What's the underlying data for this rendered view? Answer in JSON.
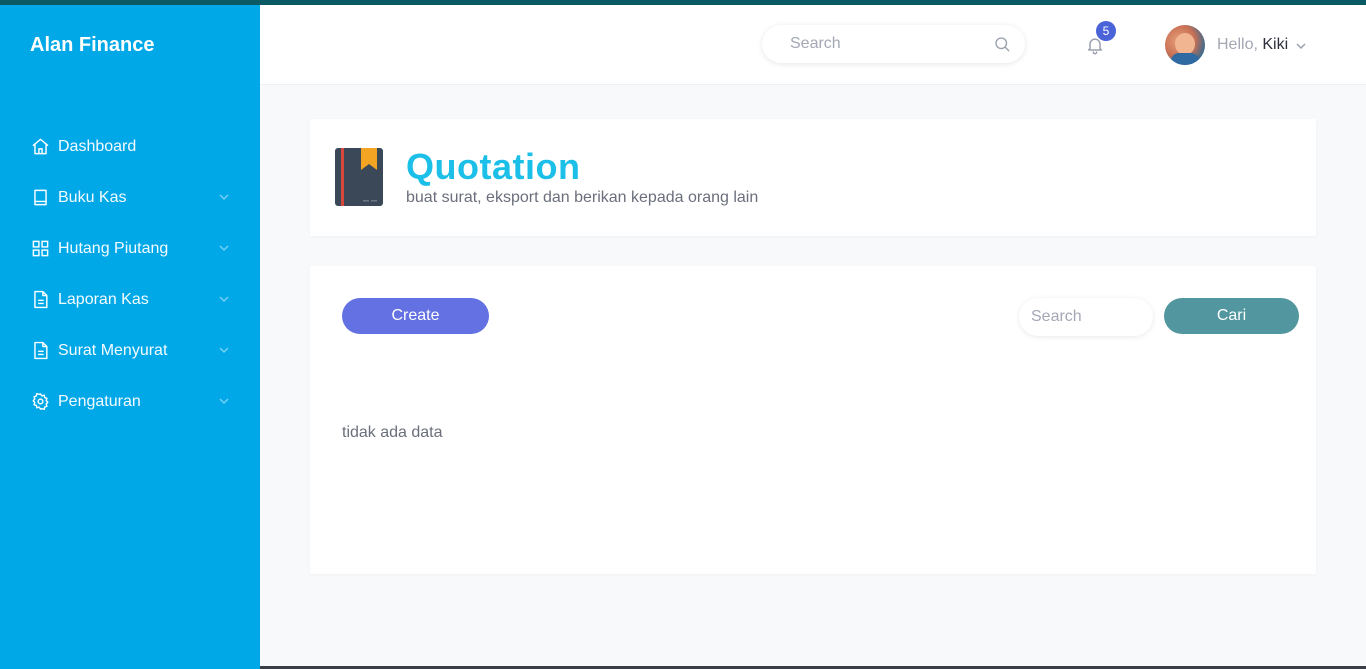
{
  "app": {
    "brand": "Alan Finance"
  },
  "sidebar": {
    "items": [
      {
        "label": "Dashboard",
        "icon": "home-icon",
        "has_submenu": false
      },
      {
        "label": "Buku Kas",
        "icon": "book-icon",
        "has_submenu": true
      },
      {
        "label": "Hutang Piutang",
        "icon": "grid-icon",
        "has_submenu": true
      },
      {
        "label": "Laporan Kas",
        "icon": "file-icon",
        "has_submenu": true
      },
      {
        "label": "Surat Menyurat",
        "icon": "file-icon",
        "has_submenu": true
      },
      {
        "label": "Pengaturan",
        "icon": "gear-icon",
        "has_submenu": true
      }
    ]
  },
  "topbar": {
    "search_placeholder": "Search",
    "notification_count": "5",
    "greeting": "Hello,",
    "user_name": "Kiki"
  },
  "page": {
    "title": "Quotation",
    "subtitle": "buat surat, eksport dan berikan kepada orang lain"
  },
  "content": {
    "create_label": "Create",
    "search_placeholder": "Search",
    "search_button_label": "Cari",
    "empty_message": "tidak ada data"
  },
  "colors": {
    "sidebar_bg": "#00a8e8",
    "title": "#1bbfe8",
    "create_button": "#6371e3",
    "search_button": "#5297a0",
    "badge": "#4b63d8"
  }
}
